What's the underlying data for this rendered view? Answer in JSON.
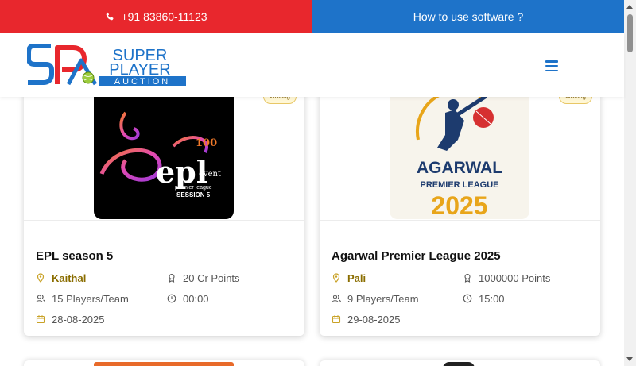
{
  "topbar": {
    "phone_icon": "phone-icon",
    "phone": "+91 83860-11123",
    "howto": "How to use software ?"
  },
  "navbar": {
    "logo_text_1": "SUPER",
    "logo_text_2": "PLAYER",
    "logo_text_3": "AUCTION",
    "menu_icon": "hamburger-icon"
  },
  "colors": {
    "red": "#e8272d",
    "blue": "#1e73c9",
    "gold": "#8a6d00"
  },
  "cards": [
    {
      "status": "Waiting",
      "title": "EPL season 5",
      "place": "Kaithal",
      "points": "20 Cr Points",
      "players": "15 Players/Team",
      "time": "00:00",
      "date": "28-08-2025",
      "poster": {
        "line1": "epl",
        "line2": "event",
        "line3": "premier league",
        "line4": "SESSION 5",
        "mark": "100"
      }
    },
    {
      "status": "Waiting",
      "title": "Agarwal Premier League 2025",
      "place": "Pali",
      "points": "1000000 Points",
      "players": "9 Players/Team",
      "time": "15:00",
      "date": "29-08-2025",
      "poster": {
        "line1": "AGARWAL",
        "line2": "PREMIER LEAGUE",
        "line3": "2025"
      }
    }
  ]
}
